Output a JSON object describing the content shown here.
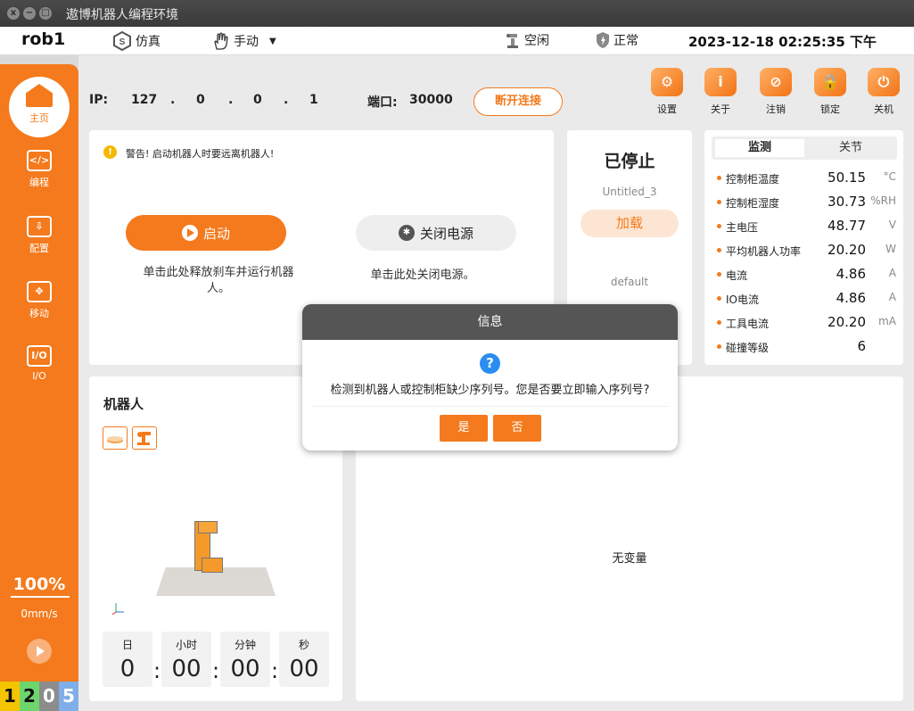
{
  "window": {
    "title": "遨博机器人编程环境",
    "close": "x",
    "minimize": "−",
    "maximize": "□"
  },
  "topbar": {
    "robot": "rob1",
    "sim_label": "仿真",
    "mode_label": "手动",
    "state_label": "空闲",
    "health_label": "正常",
    "datetime": "2023-12-18 02:25:35 下午"
  },
  "sidebar": {
    "items": [
      {
        "label": "主页"
      },
      {
        "label": "编程",
        "icon": "</>"
      },
      {
        "label": "配置",
        "icon": "⇩"
      },
      {
        "label": "移动",
        "icon": "✥"
      },
      {
        "label": "I/O",
        "icon": "I/O"
      }
    ],
    "speed_percent": "100%",
    "speed_value": "0mm/s",
    "badges": [
      "1",
      "2",
      "0",
      "5"
    ]
  },
  "connection": {
    "ip_label": "IP:",
    "ip": [
      "127",
      ".",
      "0",
      ".",
      "0",
      ".",
      "1"
    ],
    "port_label": "端口:",
    "port": "30000",
    "disconnect": "断开连接"
  },
  "toolbar": {
    "items": [
      {
        "label": "设置",
        "icon": "⚙"
      },
      {
        "label": "关于",
        "icon": "i"
      },
      {
        "label": "注销",
        "icon": "⊘"
      },
      {
        "label": "锁定",
        "icon": "🔒"
      },
      {
        "label": "关机",
        "icon": "⏻"
      }
    ]
  },
  "start_panel": {
    "warning_icon": "!",
    "warning": "警告! 启动机器人时要远离机器人!",
    "start_button": "启动",
    "start_desc": "单击此处释放刹车并运行机器人。",
    "power_icon": "✱",
    "power_button": "关闭电源",
    "power_desc": "单击此处关闭电源。"
  },
  "state_panel": {
    "title": "已停止",
    "program": "Untitled_3",
    "load": "加载",
    "default": "default"
  },
  "monitor": {
    "tabs": [
      "监测",
      "关节"
    ],
    "rows": [
      {
        "label": "控制柜温度",
        "value": "50.15",
        "unit": "°C"
      },
      {
        "label": "控制柜湿度",
        "value": "30.73",
        "unit": "%RH"
      },
      {
        "label": "主电压",
        "value": "48.77",
        "unit": "V"
      },
      {
        "label": "平均机器人功率",
        "value": "20.20",
        "unit": "W"
      },
      {
        "label": "电流",
        "value": "4.86",
        "unit": "A"
      },
      {
        "label": "IO电流",
        "value": "4.86",
        "unit": "A"
      },
      {
        "label": "工具电流",
        "value": "20.20",
        "unit": "mA"
      },
      {
        "label": "碰撞等级",
        "value": "6",
        "unit": ""
      }
    ]
  },
  "robot_panel": {
    "title": "机器人",
    "timer": [
      {
        "label": "日",
        "value": "0"
      },
      {
        "label": "小时",
        "value": "00"
      },
      {
        "label": "分钟",
        "value": "00"
      },
      {
        "label": "秒",
        "value": "00"
      }
    ],
    "separator": ":"
  },
  "variables": {
    "empty": "无变量"
  },
  "dialog": {
    "title": "信息",
    "icon": "?",
    "message": "检测到机器人或控制柜缺少序列号。您是否要立即输入序列号?",
    "yes": "是",
    "no": "否"
  }
}
